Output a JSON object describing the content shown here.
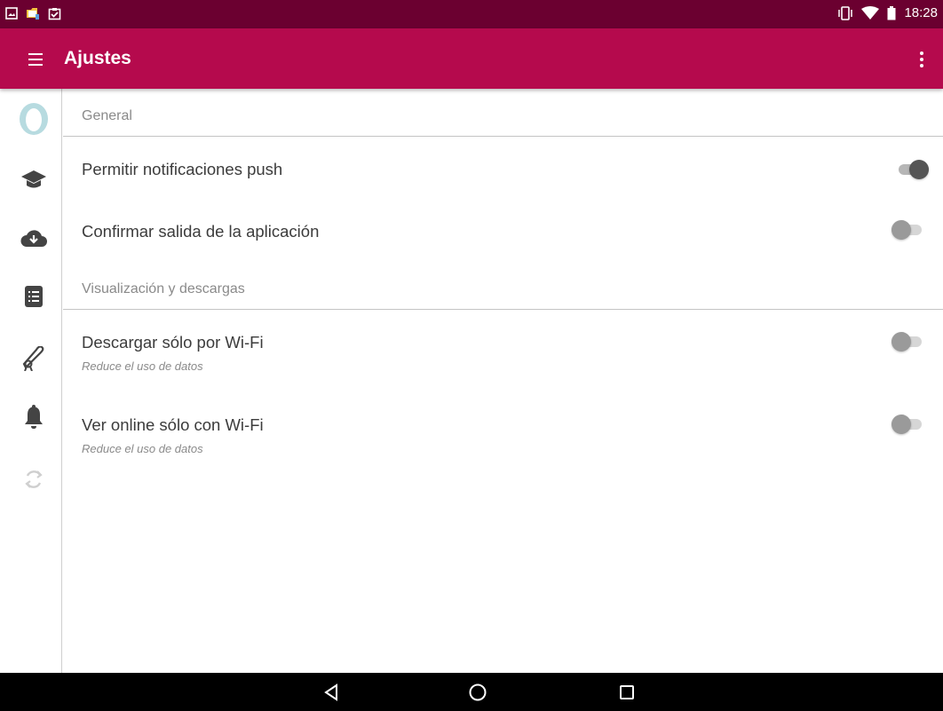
{
  "status_bar": {
    "time": "18:28",
    "left_icons": [
      "image-notification-icon",
      "folder-notification-icon",
      "clipboard-check-icon"
    ],
    "right_icons": [
      "vibrate-icon",
      "wifi-icon",
      "battery-icon"
    ]
  },
  "app_bar": {
    "title": "Ajustes",
    "background": "#b50a4d",
    "status_color": "#6b0030"
  },
  "rail": {
    "items": [
      {
        "name": "avatar-icon"
      },
      {
        "name": "graduation-cap-icon"
      },
      {
        "name": "cloud-download-icon"
      },
      {
        "name": "list-document-icon"
      },
      {
        "name": "diploma-icon"
      },
      {
        "name": "bell-icon"
      },
      {
        "name": "sync-icon"
      }
    ]
  },
  "sections": [
    {
      "header": "General",
      "items": [
        {
          "title": "Permitir notificaciones push",
          "enabled": true
        },
        {
          "title": "Confirmar salida de la aplicación",
          "enabled": false
        }
      ]
    },
    {
      "header": "Visualización y descargas",
      "items": [
        {
          "title": "Descargar sólo por Wi-Fi",
          "subtitle": "Reduce el uso de datos",
          "enabled": false
        },
        {
          "title": "Ver online sólo con Wi-Fi",
          "subtitle": "Reduce el uso de datos",
          "enabled": false
        }
      ]
    }
  ],
  "nav_bar": {
    "buttons": [
      "back-icon",
      "home-icon",
      "recents-icon"
    ]
  }
}
